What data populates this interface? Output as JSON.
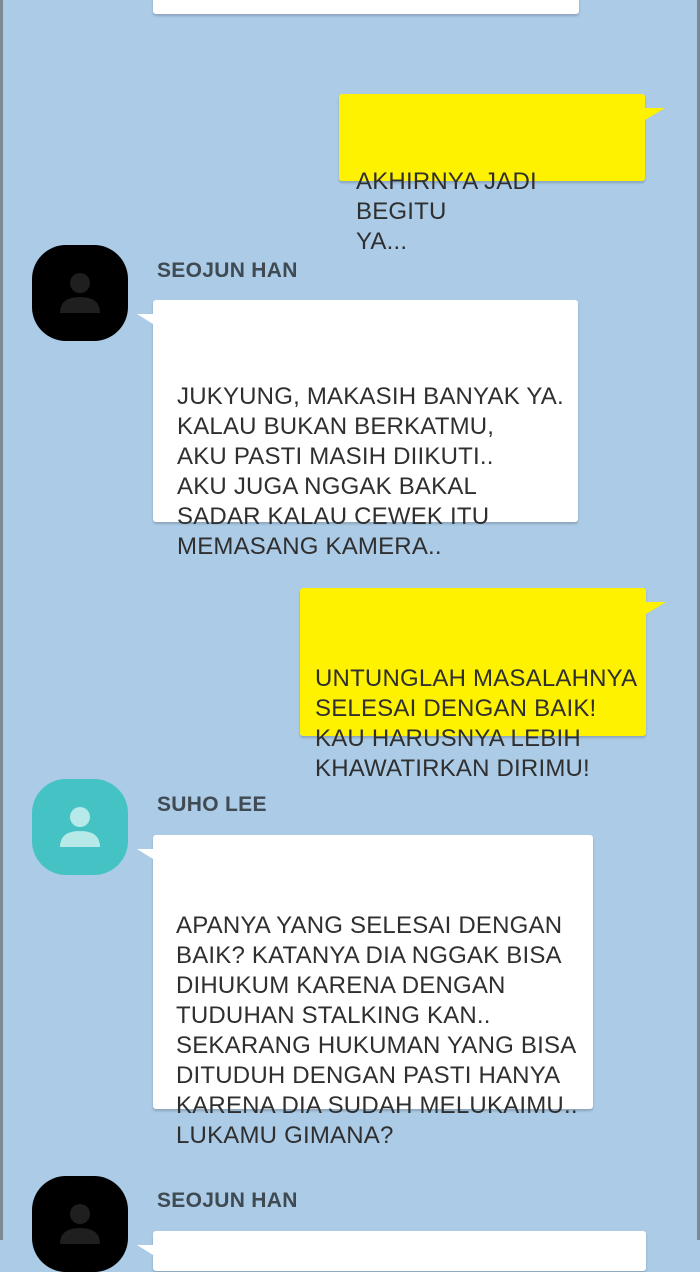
{
  "colors": {
    "background": "#abcbe6",
    "incoming_bubble": "#ffffff",
    "outgoing_bubble": "#fef200",
    "avatar_dark": "#000000",
    "avatar_teal": "#45c3c4"
  },
  "messages": [
    {
      "direction": "outgoing",
      "text": "AKHIRNYA JADI BEGITU\nYA..."
    },
    {
      "direction": "incoming",
      "sender": "SEOJUN HAN",
      "avatar_icon": "user-silhouette-icon",
      "text": "JUKYUNG, MAKASIH BANYAK YA.\nKALAU BUKAN BERKATMU,\nAKU PASTI MASIH DIIKUTI..\nAKU JUGA NGGAK BAKAL\nSADAR KALAU CEWEK ITU\nMEMASANG KAMERA.."
    },
    {
      "direction": "outgoing",
      "text": "UNTUNGLAH MASALAHNYA\nSELESAI DENGAN BAIK!\nKAU HARUSNYA LEBIH\nKHAWATIRKAN DIRIMU!"
    },
    {
      "direction": "incoming",
      "sender": "SUHO LEE",
      "avatar_icon": "user-silhouette-icon",
      "text": "APANYA YANG SELESAI DENGAN\nBAIK? KATANYA DIA NGGAK BISA\nDIHUKUM KARENA DENGAN\nTUDUHAN STALKING KAN..\nSEKARANG HUKUMAN YANG BISA\nDITUDUH DENGAN PASTI HANYA\nKARENA DIA SUDAH MELUKAIMU..\nLUKAMU GIMANA?"
    },
    {
      "direction": "incoming",
      "sender": "SEOJUN HAN",
      "avatar_icon": "user-silhouette-icon",
      "text": ""
    }
  ]
}
